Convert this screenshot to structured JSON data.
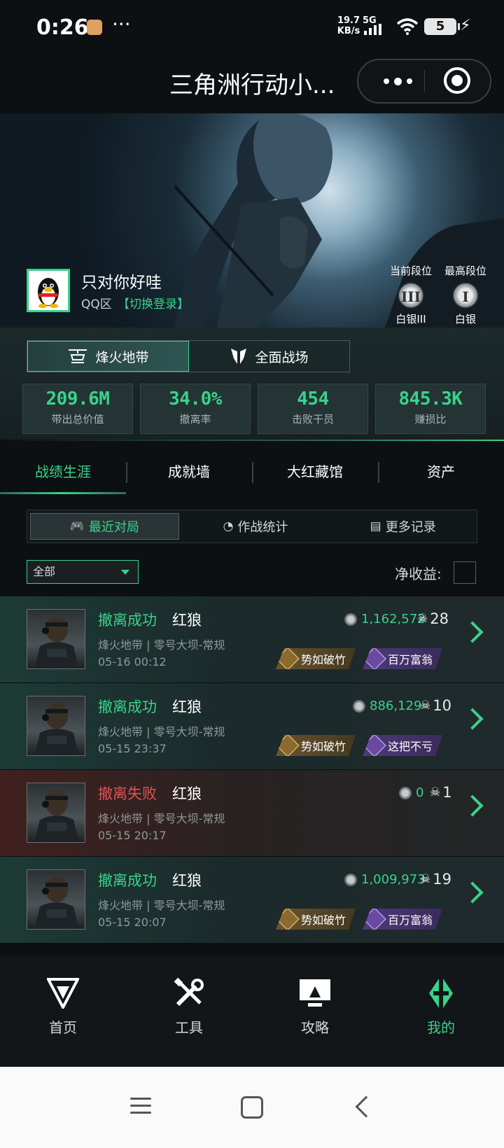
{
  "status_bar": {
    "time": "0:26",
    "more_dots": "···",
    "net_speed_value": "19.7",
    "net_speed_unit": "KB/s",
    "network": "5G",
    "battery": "5"
  },
  "nav": {
    "title": "三角洲行动小..."
  },
  "profile": {
    "name": "只对你好哇",
    "zone": "QQ区",
    "switch_login": "【切换登录】",
    "ranks": [
      {
        "label": "当前段位",
        "badge": "III",
        "value": "白银III"
      },
      {
        "label": "最高段位",
        "badge": "I",
        "value": "白银"
      }
    ]
  },
  "modes": [
    {
      "label": "烽火地带",
      "icon": "helicopter-icon",
      "active": true
    },
    {
      "label": "全面战场",
      "icon": "wing-emblem-icon",
      "active": false
    }
  ],
  "stats": [
    {
      "value": "209.6M",
      "label": "带出总价值"
    },
    {
      "value": "34.0%",
      "label": "撤离率"
    },
    {
      "value": "454",
      "label": "击败干员"
    },
    {
      "value": "845.3K",
      "label": "赚损比"
    }
  ],
  "main_tabs": [
    "战绩生涯",
    "成就墙",
    "大红藏馆",
    "资产"
  ],
  "sub_tabs": [
    {
      "label": "最近对局",
      "icon": "🎮"
    },
    {
      "label": "作战统计",
      "icon": "◔"
    },
    {
      "label": "更多记录",
      "icon": "▤"
    }
  ],
  "filter": {
    "selected": "全部",
    "net_income_label": "净收益:"
  },
  "matches": [
    {
      "result": "撤离成功",
      "status": "success",
      "operator": "红狼",
      "map": "烽火地带 | 零号大坝-常规",
      "time": "05-16 00:12",
      "value": "1,162,572",
      "kills": "28",
      "badges": [
        "势如破竹",
        "百万富翁"
      ]
    },
    {
      "result": "撤离成功",
      "status": "success",
      "operator": "红狼",
      "map": "烽火地带 | 零号大坝-常规",
      "time": "05-15 23:37",
      "value": "886,129",
      "kills": "10",
      "badges": [
        "势如破竹",
        "这把不亏"
      ]
    },
    {
      "result": "撤离失败",
      "status": "fail",
      "operator": "红狼",
      "map": "烽火地带 | 零号大坝-常规",
      "time": "05-15 20:17",
      "value": "0",
      "kills": "1",
      "badges": []
    },
    {
      "result": "撤离成功",
      "status": "success",
      "operator": "红狼",
      "map": "烽火地带 | 零号大坝-常规",
      "time": "05-15 20:07",
      "value": "1,009,973",
      "kills": "19",
      "badges": [
        "势如破竹",
        "百万富翁"
      ]
    }
  ],
  "bottom_nav": [
    {
      "label": "首页",
      "icon": "home-delta-icon",
      "active": false
    },
    {
      "label": "工具",
      "icon": "tools-icon",
      "active": false
    },
    {
      "label": "攻略",
      "icon": "guide-monitor-icon",
      "active": false
    },
    {
      "label": "我的",
      "icon": "profile-emblem-icon",
      "active": true
    }
  ],
  "colors": {
    "accent": "#3ad28a",
    "fail": "#e05252",
    "background": "#0d1012"
  }
}
